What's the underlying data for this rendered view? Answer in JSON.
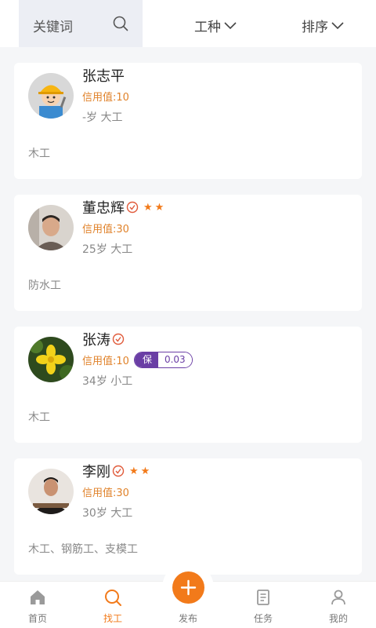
{
  "search": {
    "placeholder": "关键词"
  },
  "filters": {
    "trade": "工种",
    "sort": "排序"
  },
  "workers": [
    {
      "name": "张志平",
      "verified": false,
      "stars": "",
      "credit": "信用值:10",
      "badge": null,
      "info": "-岁  大工",
      "skills": "木工"
    },
    {
      "name": "董忠辉",
      "verified": true,
      "stars": "★★",
      "credit": "信用值:30",
      "badge": null,
      "info": "25岁  大工",
      "skills": "防水工"
    },
    {
      "name": "张涛",
      "verified": true,
      "stars": "",
      "credit": "信用值:10",
      "badge": {
        "label": "保",
        "value": "0.03"
      },
      "info": "34岁  小工",
      "skills": "木工"
    },
    {
      "name": "李刚",
      "verified": true,
      "stars": "★★",
      "credit": "信用值:30",
      "badge": null,
      "info": "30岁  大工",
      "skills": "木工、钢筋工、支模工"
    }
  ],
  "tabs": [
    {
      "label": "首页",
      "icon": "home-icon",
      "active": false
    },
    {
      "label": "找工",
      "icon": "search-icon",
      "active": true
    },
    {
      "label": "发布",
      "icon": "plus-icon",
      "active": false
    },
    {
      "label": "任务",
      "icon": "task-icon",
      "active": false
    },
    {
      "label": "我的",
      "icon": "user-icon",
      "active": false
    }
  ],
  "colors": {
    "accent": "#f27a1a",
    "credit": "#e0822a",
    "badge": "#6a3ea5",
    "verify": "#e05a3a"
  }
}
